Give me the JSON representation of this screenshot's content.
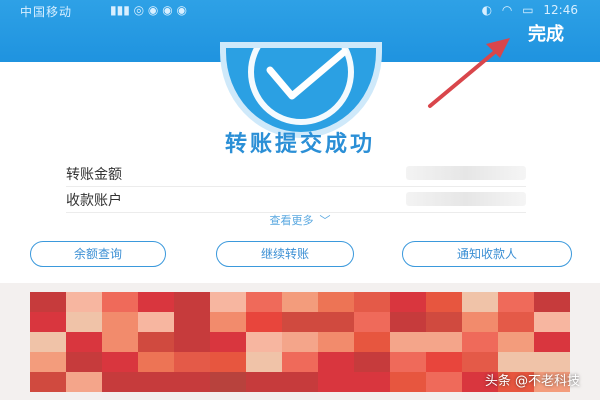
{
  "status_bar": {
    "carrier": "中国移动",
    "time": "12:46"
  },
  "header": {
    "done_label": "完成"
  },
  "success": {
    "title": "转账提交成功"
  },
  "details": {
    "rows": [
      {
        "label": "转账金额"
      },
      {
        "label": "收款账户"
      }
    ],
    "view_more": "查看更多"
  },
  "actions": {
    "balance_query": "余额查询",
    "continue_transfer": "继续转账",
    "notify_payee": "通知收款人"
  },
  "watermark": "头条 @不老科技",
  "colors": {
    "header_blue": "#2196e3",
    "accent_blue": "#2b8fd6",
    "annotation_arrow": "#d9464b"
  }
}
